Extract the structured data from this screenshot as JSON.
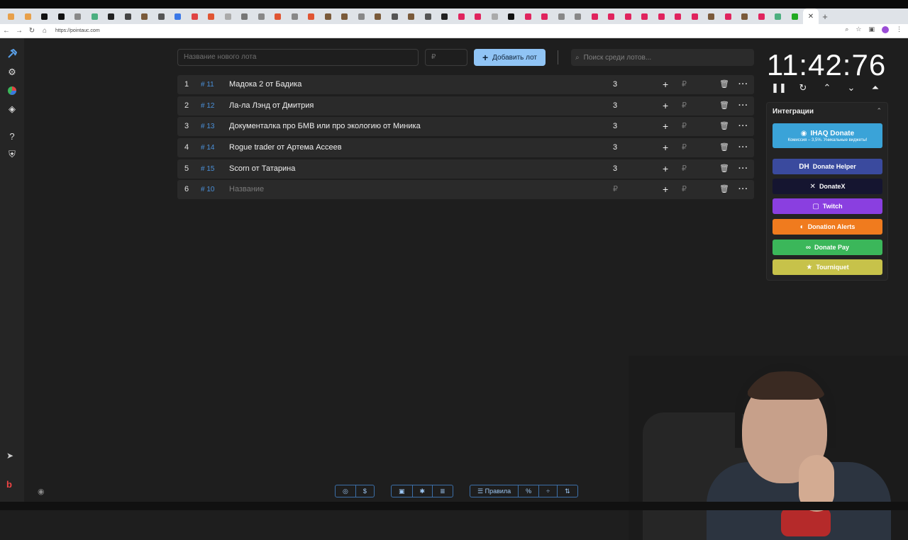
{
  "browser": {
    "url": "https://pointauc.com",
    "tab_colors": [
      "#e8a04a",
      "#e8a04a",
      "#111111",
      "#111111",
      "#888888",
      "#4caf80",
      "#222222",
      "#444444",
      "#7a5a3a",
      "#555555",
      "#3b78e7",
      "#e04444",
      "#e05533",
      "#aaaaaa",
      "#777777",
      "#888888",
      "#e05533",
      "#888888",
      "#e05533",
      "#7a5a3a",
      "#7a5a3a",
      "#888888",
      "#7a5a3a",
      "#555555",
      "#7a5a3a",
      "#555555",
      "#222222",
      "#e0245e",
      "#e0245e",
      "#aaaaaa",
      "#111111",
      "#e0245e",
      "#e0245e",
      "#888888",
      "#888888",
      "#e0245e",
      "#e0245e",
      "#e0245e",
      "#e0245e",
      "#e0245e",
      "#e0245e",
      "#e0245e",
      "#7a5a3a",
      "#e0245e",
      "#7a5a3a",
      "#e0245e",
      "#4caf80",
      "#22aa22"
    ]
  },
  "sidebar": {
    "icons": [
      "hammer-icon",
      "gear-icon",
      "pie-chart-icon",
      "layers-icon",
      "help-icon",
      "shield-icon"
    ]
  },
  "toolbar": {
    "new_lot_placeholder": "Название нового лота",
    "amount_placeholder": "₽",
    "add_lot_label": "Добавить лот",
    "search_placeholder": "Поиск среди лотов..."
  },
  "lots": [
    {
      "num": "1",
      "id": "# 11",
      "name": "Мадока 2 от Бадика",
      "amount": "3",
      "placeholder": false
    },
    {
      "num": "2",
      "id": "# 12",
      "name": "Ла-ла Лэнд от Дмитрия",
      "amount": "3",
      "placeholder": false
    },
    {
      "num": "3",
      "id": "# 13",
      "name": "Документалка про БМВ или про экологию от Миника",
      "amount": "3",
      "placeholder": false
    },
    {
      "num": "4",
      "id": "# 14",
      "name": "Rogue trader от Артема Ассеев",
      "amount": "3",
      "placeholder": false
    },
    {
      "num": "5",
      "id": "# 15",
      "name": "Scorn от Татарина",
      "amount": "3",
      "placeholder": false
    },
    {
      "num": "6",
      "id": "# 10",
      "name": "Название",
      "amount": "₽",
      "placeholder": true
    }
  ],
  "lot_row_actions": {
    "add": "+",
    "currency": "₽",
    "delete": "🗑",
    "more": "···"
  },
  "timer": {
    "display": "11:42:76"
  },
  "integrations": {
    "title": "Интеграции",
    "ihaq_label": "IHAQ Donate",
    "ihaq_sub": "Комиссия – 3,5%. Уникальные виджеты!",
    "buttons": [
      {
        "label": "Donate Helper",
        "color": "#3a4a9e",
        "icon": "DH"
      },
      {
        "label": "DonateX",
        "color": "#151530",
        "icon": "✕"
      },
      {
        "label": "Twitch",
        "color": "#8a3fe0",
        "icon": "▢"
      },
      {
        "label": "Donation Alerts",
        "color": "#f07b1e",
        "icon": "◐"
      },
      {
        "label": "Donate Pay",
        "color": "#3bb75a",
        "icon": "∞"
      },
      {
        "label": "Tourniquet",
        "color": "#c7c24a",
        "icon": "★"
      }
    ]
  },
  "bottom_toolbar": {
    "rules_label": "Правила"
  }
}
